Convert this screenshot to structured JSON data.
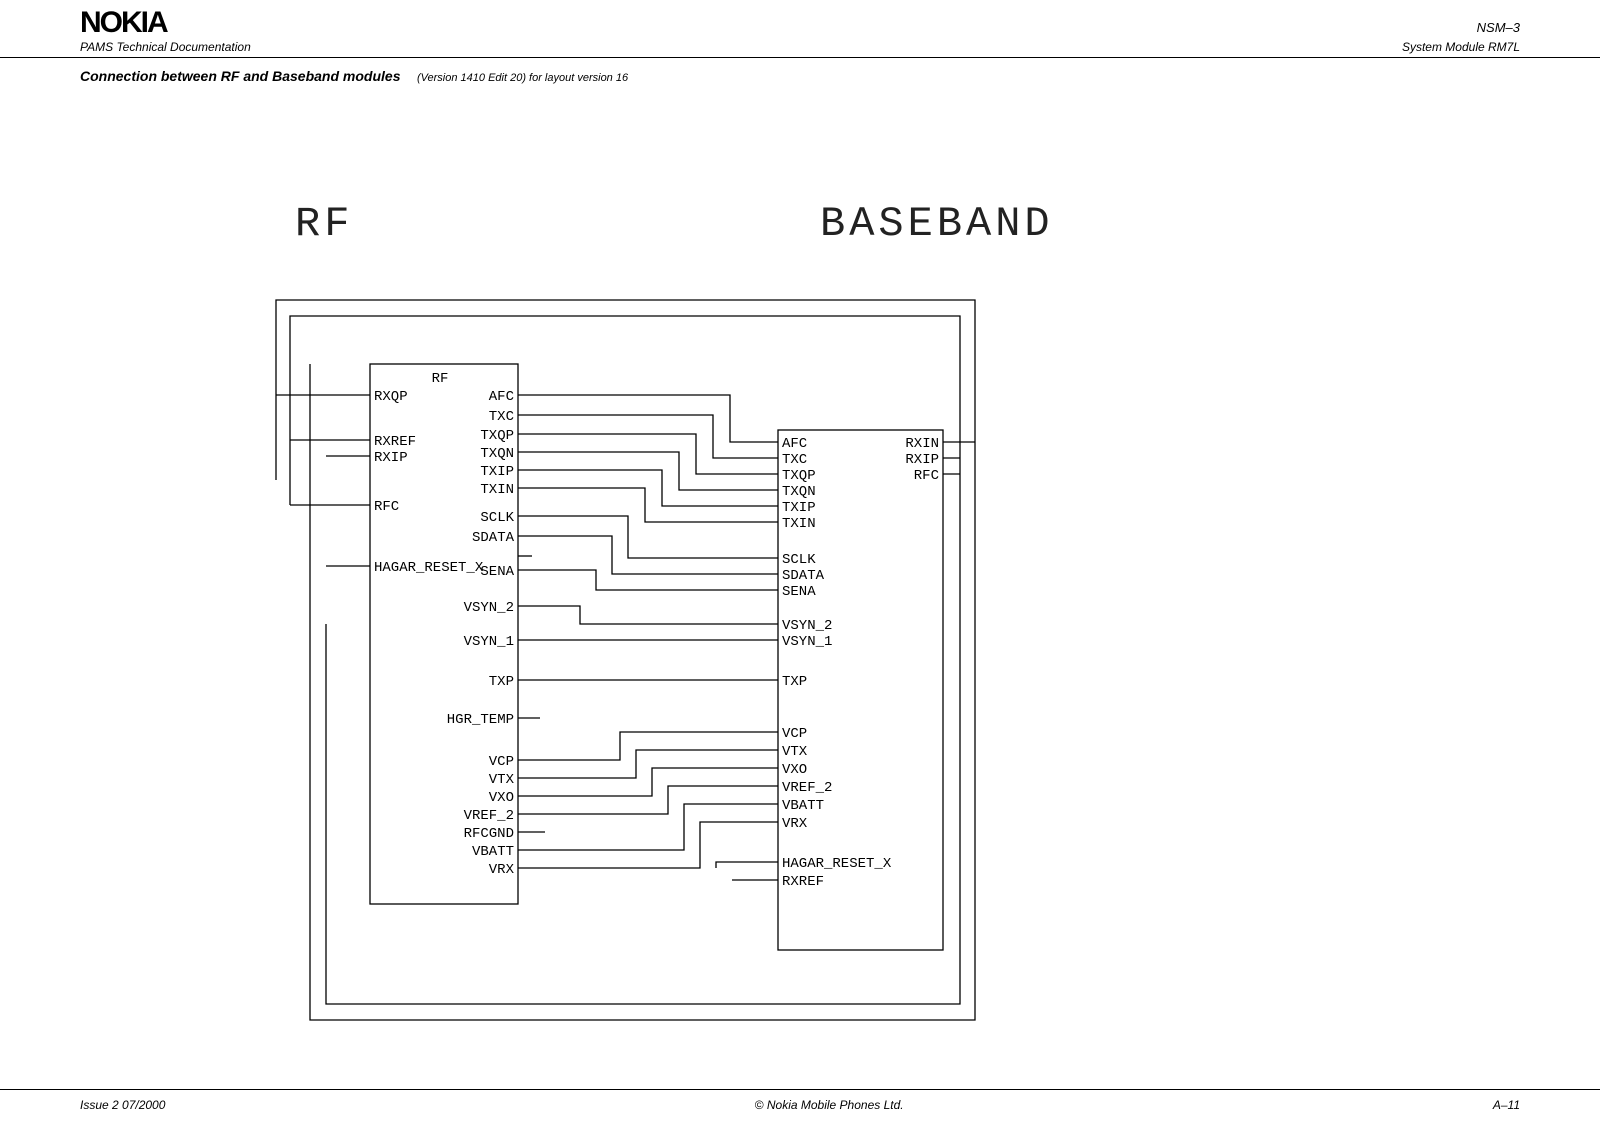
{
  "header": {
    "logo": "NOKIA",
    "sub_left": "PAMS Technical Documentation",
    "right_top": "NSM–3",
    "right_bottom": "System Module RM7L"
  },
  "doc": {
    "title": "Connection between RF and Baseband modules",
    "subtitle": "(Version 1410  Edit 20) for layout version 16"
  },
  "labels": {
    "rf": "RF",
    "baseband": "BASEBAND"
  },
  "blocks": {
    "rf_block_title": "RF",
    "rf_left": [
      "RXQP",
      "RXREF",
      "RXIP",
      "RFC",
      "HAGAR_RESET_X"
    ],
    "rf_right": [
      "AFC",
      "TXC",
      "TXQP",
      "TXQN",
      "TXIP",
      "TXIN",
      "SCLK",
      "SDATA",
      "SENA",
      "VSYN_2",
      "VSYN_1",
      "TXP",
      "HGR_TEMP",
      "VCP",
      "VTX",
      "VXO",
      "VREF_2",
      "RFCGND",
      "VBATT",
      "VRX"
    ],
    "bb_left": [
      "AFC",
      "TXC",
      "TXQP",
      "TXQN",
      "TXIP",
      "TXIN",
      "SCLK",
      "SDATA",
      "SENA",
      "VSYN_2",
      "VSYN_1",
      "TXP",
      "VCP",
      "VTX",
      "VXO",
      "VREF_2",
      "VBATT",
      "VRX",
      "HAGAR_RESET_X",
      "RXREF"
    ],
    "bb_right": [
      "RXIN",
      "RXIP",
      "RFC"
    ]
  },
  "footer": {
    "left": "Issue 2  07/2000",
    "center": "© Nokia Mobile Phones Ltd.",
    "right": "A–11"
  }
}
